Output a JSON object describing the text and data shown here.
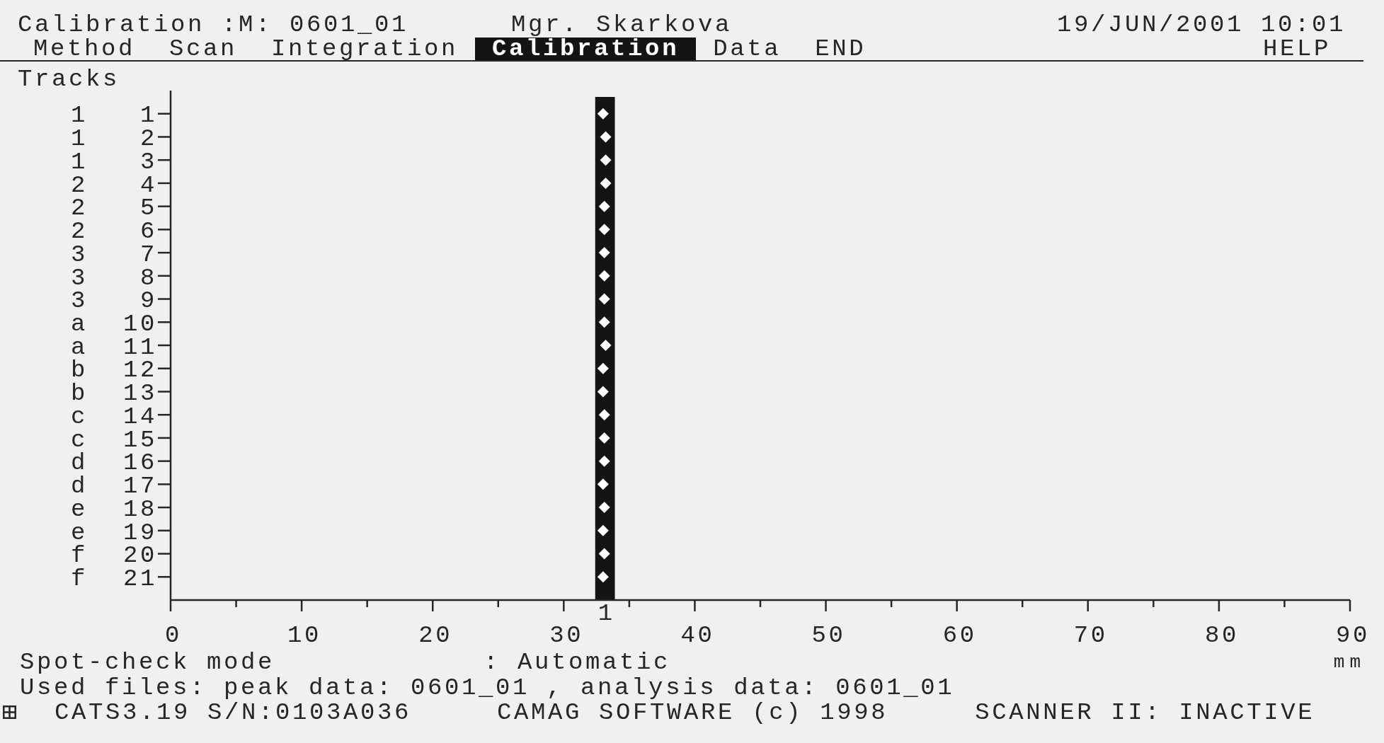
{
  "header": {
    "title": "Calibration :M: 0601_01",
    "user": "Mgr. Skarkova",
    "datetime": "19/JUN/2001 10:01"
  },
  "menu": {
    "items": [
      {
        "label": "Method",
        "selected": false
      },
      {
        "label": "Scan",
        "selected": false
      },
      {
        "label": "Integration",
        "selected": false
      },
      {
        "label": "Calibration",
        "selected": true
      },
      {
        "label": "Data",
        "selected": false
      },
      {
        "label": "END",
        "selected": false
      }
    ],
    "help": "HELP"
  },
  "plate_view": {
    "samples": [
      "1",
      "1",
      "1",
      "2",
      "2",
      "2",
      "3",
      "3",
      "3",
      "a",
      "a",
      "b",
      "b",
      "c",
      "c",
      "d",
      "d",
      "e",
      "e",
      "f",
      "f"
    ],
    "chart_data": {
      "type": "scatter",
      "ylabel": "Tracks",
      "xlabel": "mm",
      "x": [
        33.0,
        33.2,
        33.2,
        33.2,
        33.1,
        33.1,
        33.1,
        33.1,
        33.1,
        33.1,
        33.2,
        33.0,
        33.0,
        33.1,
        33.1,
        33.1,
        33.0,
        33.1,
        33.0,
        33.1,
        33.0
      ],
      "xlim": [
        0,
        90
      ],
      "ylim": [
        22,
        0
      ],
      "xticks": [
        0,
        10,
        20,
        30,
        40,
        50,
        60,
        70,
        80,
        90
      ],
      "yticks": [
        1,
        2,
        3,
        4,
        5,
        6,
        7,
        8,
        9,
        10,
        11,
        12,
        13,
        14,
        15,
        16,
        17,
        18,
        19,
        20,
        21
      ],
      "series": [
        {
          "color": "#ffffff",
          "values": [
            1,
            2,
            3,
            4,
            5,
            6,
            7,
            8,
            9,
            10,
            11,
            12,
            13,
            14,
            15,
            16,
            17,
            18,
            19,
            20,
            21
          ]
        }
      ],
      "bands": [
        {
          "axis": "x",
          "from": 32.4,
          "to": 33.9,
          "label": "1",
          "color": "#141414"
        }
      ]
    }
  },
  "spot_check": {
    "label": "Spot-check mode",
    "value": ": Automatic"
  },
  "used_files": "Used files: peak data: 0601_01 , analysis data: 0601_01",
  "status_bar": {
    "version": "CATS3.19 S/N:0103A036",
    "copyright": "CAMAG SOFTWARE (c) 1998",
    "scanner": "SCANNER II: INACTIVE"
  }
}
